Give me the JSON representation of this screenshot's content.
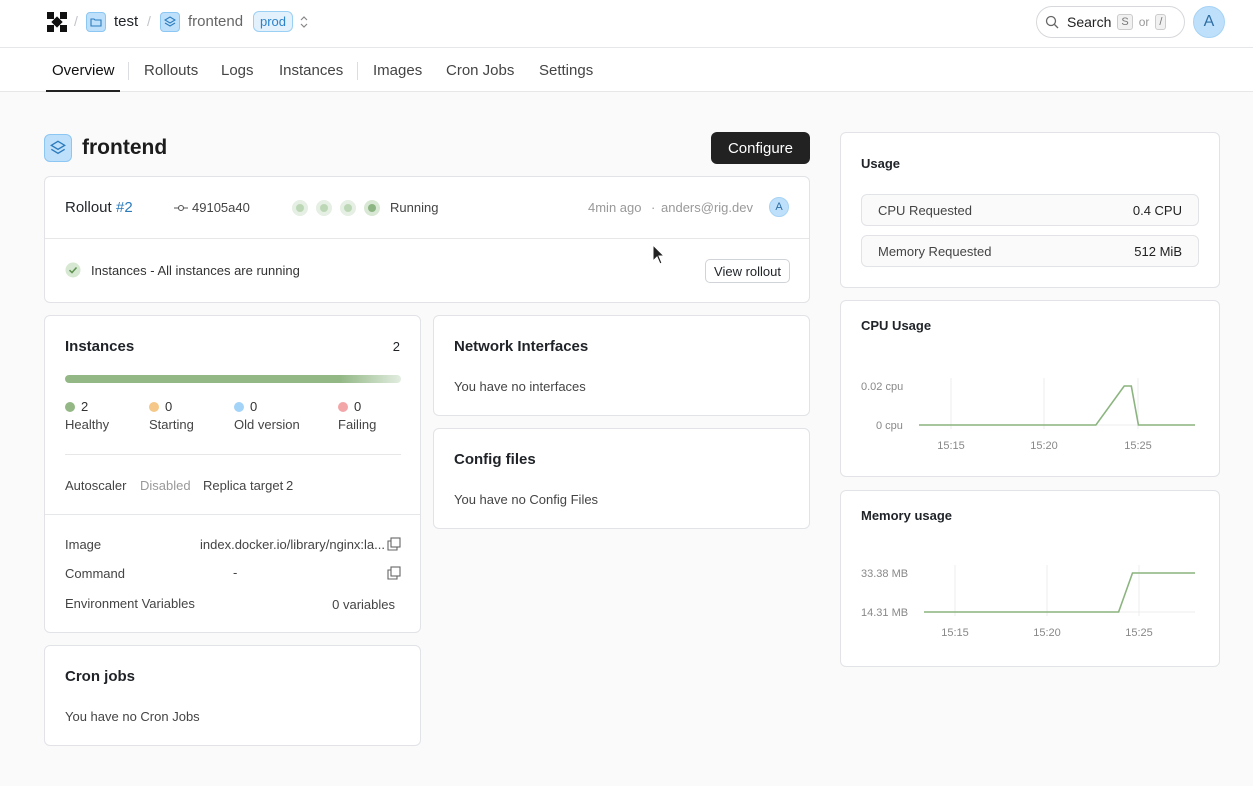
{
  "topbar": {
    "project": "test",
    "service": "frontend",
    "environment": "prod",
    "search_label": "Search",
    "search_key1": "S",
    "search_or": "or",
    "search_key2": "/",
    "user_initial": "A"
  },
  "tabs": [
    {
      "label": "Overview",
      "active": true
    },
    {
      "label": "Rollouts"
    },
    {
      "label": "Logs"
    },
    {
      "label": "Instances"
    },
    {
      "label": "Images"
    },
    {
      "label": "Cron Jobs"
    },
    {
      "label": "Settings"
    }
  ],
  "header": {
    "title": "frontend",
    "configure_label": "Configure"
  },
  "rollout": {
    "label": "Rollout",
    "number": "#2",
    "commit": "49105a40",
    "status": "Running",
    "time": "4min ago",
    "separator": "·",
    "author": "anders@rig.dev",
    "author_initial": "A",
    "message": "Instances - All instances are running",
    "view_label": "View rollout"
  },
  "instances": {
    "title": "Instances",
    "count": "2",
    "healthy_fraction": 1.0,
    "legend": [
      {
        "value": "2",
        "label": "Healthy",
        "color": "#93b886"
      },
      {
        "value": "0",
        "label": "Starting",
        "color": "#f5c889"
      },
      {
        "value": "0",
        "label": "Old version",
        "color": "#a3d3f7"
      },
      {
        "value": "0",
        "label": "Failing",
        "color": "#f2a6a8"
      }
    ],
    "autoscaler_label": "Autoscaler",
    "autoscaler_value": "Disabled",
    "replica_label": "Replica target",
    "replica_value": "2",
    "image_label": "Image",
    "image_value": "index.docker.io/library/nginx:la...",
    "command_label": "Command",
    "command_value": "-",
    "env_label": "Environment Variables",
    "env_value": "0 variables"
  },
  "network": {
    "title": "Network Interfaces",
    "empty": "You have no interfaces"
  },
  "config_files": {
    "title": "Config files",
    "empty": "You have no Config Files"
  },
  "cron": {
    "title": "Cron jobs",
    "empty": "You have no Cron Jobs"
  },
  "usage": {
    "title": "Usage",
    "cpu_label": "CPU Requested",
    "cpu_value": "0.4 CPU",
    "mem_label": "Memory Requested",
    "mem_value": "512 MiB"
  },
  "chart_data": [
    {
      "type": "line",
      "title": "CPU Usage",
      "y_tick_labels": [
        "0.02 cpu",
        "0 cpu"
      ],
      "x_tick_labels": [
        "15:15",
        "15:20",
        "15:25"
      ],
      "series": [
        {
          "x": [
            15.08,
            15.13,
            15.18,
            15.23,
            15.28,
            15.33,
            15.37,
            15.38,
            15.39,
            15.4,
            15.42,
            15.47
          ],
          "y": [
            0,
            0,
            0,
            0,
            0,
            0,
            0.02,
            0.02,
            0,
            0,
            0,
            0
          ]
        }
      ],
      "ylim": [
        0,
        0.02
      ],
      "color": "#8bb47f"
    },
    {
      "type": "line",
      "title": "Memory usage",
      "y_tick_labels": [
        "33.38 MB",
        "14.31 MB"
      ],
      "x_tick_labels": [
        "15:15",
        "15:20",
        "15:25"
      ],
      "series": [
        {
          "x": [
            15.08,
            15.13,
            15.18,
            15.23,
            15.28,
            15.33,
            15.36,
            15.38,
            15.42,
            15.47
          ],
          "y": [
            14.31,
            14.31,
            14.31,
            14.31,
            14.31,
            14.31,
            14.31,
            33.38,
            33.38,
            33.38
          ]
        }
      ],
      "ylim": [
        14.31,
        33.38
      ],
      "color": "#8bb47f"
    }
  ]
}
